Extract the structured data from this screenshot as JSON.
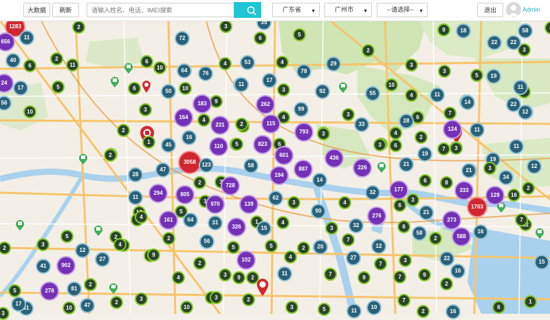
{
  "toolbar": {
    "bigdata_label": "大数据",
    "refresh_label": "刷新",
    "search_placeholder": "请输入姓名、电话、IMEI搜索",
    "province_value": "广东省",
    "city_value": "广州市",
    "district_value": "--请选择--",
    "logout_label": "退出",
    "user_name": "Admin"
  },
  "map": {
    "cluster_colors": {
      "small": "#89ca2b",
      "medium": "#2a6179",
      "large": "#7431b5",
      "huge": "#d1262f"
    },
    "clusters": [
      "1283",
      "656",
      "11",
      "40",
      "6",
      "2",
      "11",
      "24",
      "17",
      "5",
      "56",
      "10",
      "28",
      "2",
      "1",
      "13",
      "5",
      "2",
      "15",
      "22",
      "22",
      "16",
      "19",
      "3",
      "41",
      "902",
      "81",
      "12",
      "27",
      "2",
      "278",
      "2",
      "2",
      "47",
      "31",
      "5",
      "9",
      "2",
      "22",
      "3",
      "2",
      "3",
      "1",
      "3",
      "6",
      "2",
      "3",
      "35",
      "19",
      "58",
      "72",
      "5",
      "29",
      "2",
      "6",
      "10",
      "64",
      "76",
      "4",
      "53",
      "10",
      "4",
      "78",
      "29",
      "11",
      "3",
      "9",
      "3",
      "5",
      "19",
      "22",
      "18",
      "9",
      "50",
      "11",
      "17",
      "3",
      "92",
      "55",
      "10",
      "4",
      "3",
      "11",
      "7",
      "11",
      "12",
      "6",
      "4",
      "2",
      "3",
      "3",
      "11",
      "6",
      "3",
      "183",
      "262",
      "99",
      "4",
      "3",
      "4",
      "14",
      "12",
      "164",
      "231",
      "2",
      "115",
      "793",
      "3",
      "33",
      "28",
      "124",
      "11",
      "8",
      "6",
      "45",
      "110",
      "5",
      "823",
      "5",
      "436",
      "6",
      "3",
      "7",
      "11",
      "19",
      "3",
      "12",
      "16",
      "2",
      "3058",
      "123",
      "5",
      "58",
      "601",
      "887",
      "226",
      "21",
      "50",
      "34",
      "3",
      "2",
      "47",
      "3",
      "728",
      "194",
      "14",
      "6",
      "8",
      "21",
      "333",
      "4",
      "2",
      "294",
      "805",
      "1",
      "3",
      "62",
      "4",
      "32",
      "177",
      "3",
      "1703",
      "129",
      "11",
      "4",
      "5",
      "970",
      "139",
      "1",
      "90",
      "6",
      "276",
      "21",
      "273",
      "6",
      "7",
      "161",
      "64",
      "31",
      "326",
      "15",
      "4",
      "3",
      "32",
      "58",
      "588",
      "2",
      "16",
      "4",
      "2",
      "56",
      "5",
      "4",
      "2",
      "20",
      "7",
      "12",
      "27",
      "3",
      "5",
      "9",
      "2",
      "102",
      "4",
      "3",
      "9",
      "2",
      "11",
      "7",
      "9",
      "7",
      "7",
      "9",
      "22",
      "2",
      "7",
      "16",
      "3",
      "3",
      "2",
      "7",
      "3",
      "10",
      "16",
      "6",
      "17",
      "3",
      "10",
      "10",
      "5",
      "11",
      "2"
    ]
  },
  "colors": {
    "accent": "#1fc6d5",
    "admin_text": "#1fb6c8"
  }
}
